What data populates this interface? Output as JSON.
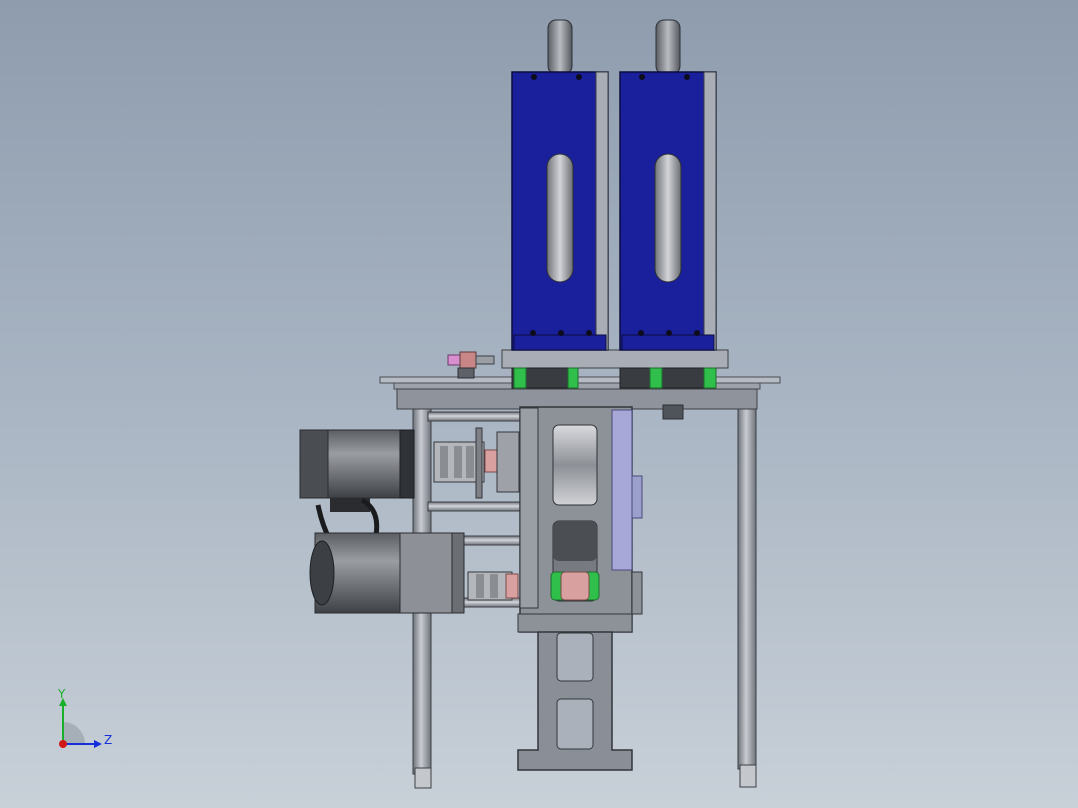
{
  "triad": {
    "y_label": "Y",
    "z_label": "Z",
    "colors": {
      "y": "#18b02a",
      "z": "#1530d8",
      "x": "#d01818"
    }
  },
  "palette": {
    "frame": "#8a8f97",
    "frame_dark": "#5e636b",
    "cylinder_blue": "#1a1f9c",
    "accent_green": "#2fbf4a",
    "accent_pink": "#d89a9a",
    "bracket_purple": "#a8a8d8",
    "motor_dark": "#4a4d52"
  }
}
